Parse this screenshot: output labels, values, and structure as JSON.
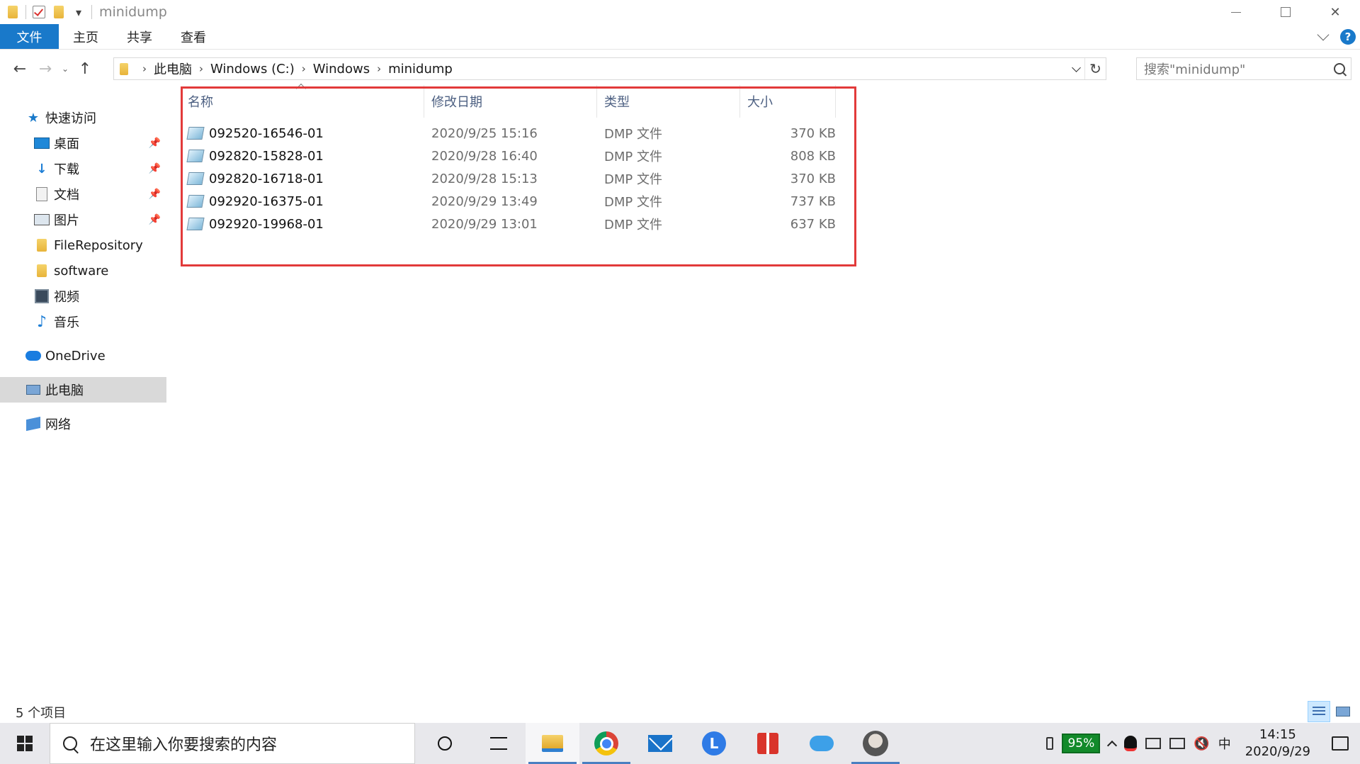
{
  "window": {
    "title": "minidump",
    "qat_dropdown": "▾"
  },
  "ribbon": {
    "tabs": [
      {
        "label": "文件",
        "active": true
      },
      {
        "label": "主页"
      },
      {
        "label": "共享"
      },
      {
        "label": "查看"
      }
    ],
    "help": "?"
  },
  "nav": {
    "back": "←",
    "forward": "→",
    "recent": "⌄",
    "up": "↑",
    "breadcrumbs": [
      "此电脑",
      "Windows (C:)",
      "Windows",
      "minidump"
    ],
    "refresh": "↻"
  },
  "search": {
    "placeholder": "搜索\"minidump\""
  },
  "sidebar": {
    "quick_access": "快速访问",
    "pinned": [
      {
        "label": "桌面",
        "icon": "desktop-icon"
      },
      {
        "label": "下载",
        "icon": "download-icon"
      },
      {
        "label": "文档",
        "icon": "document-icon"
      },
      {
        "label": "图片",
        "icon": "picture-icon"
      }
    ],
    "folders": [
      {
        "label": "FileRepository",
        "icon": "folder-icon"
      },
      {
        "label": "software",
        "icon": "folder-icon"
      },
      {
        "label": "视频",
        "icon": "video-icon"
      },
      {
        "label": "音乐",
        "icon": "music-icon"
      }
    ],
    "onedrive": "OneDrive",
    "this_pc": "此电脑",
    "network": "网络"
  },
  "table": {
    "columns": {
      "name": "名称",
      "date": "修改日期",
      "type": "类型",
      "size": "大小"
    },
    "rows": [
      {
        "name": "092520-16546-01",
        "date": "2020/9/25 15:16",
        "type": "DMP 文件",
        "size": "370 KB"
      },
      {
        "name": "092820-15828-01",
        "date": "2020/9/28 16:40",
        "type": "DMP 文件",
        "size": "808 KB"
      },
      {
        "name": "092820-16718-01",
        "date": "2020/9/28 15:13",
        "type": "DMP 文件",
        "size": "370 KB"
      },
      {
        "name": "092920-16375-01",
        "date": "2020/9/29 13:49",
        "type": "DMP 文件",
        "size": "737 KB"
      },
      {
        "name": "092920-19968-01",
        "date": "2020/9/29 13:01",
        "type": "DMP 文件",
        "size": "637 KB"
      }
    ]
  },
  "status": {
    "item_count": "5 个项目"
  },
  "taskbar": {
    "search_placeholder": "在这里输入你要搜索的内容",
    "battery": "95%",
    "ime": "中",
    "time": "14:15",
    "date": "2020/9/29",
    "highlight_color": "#e23a3a",
    "accent": "#1979ca"
  }
}
